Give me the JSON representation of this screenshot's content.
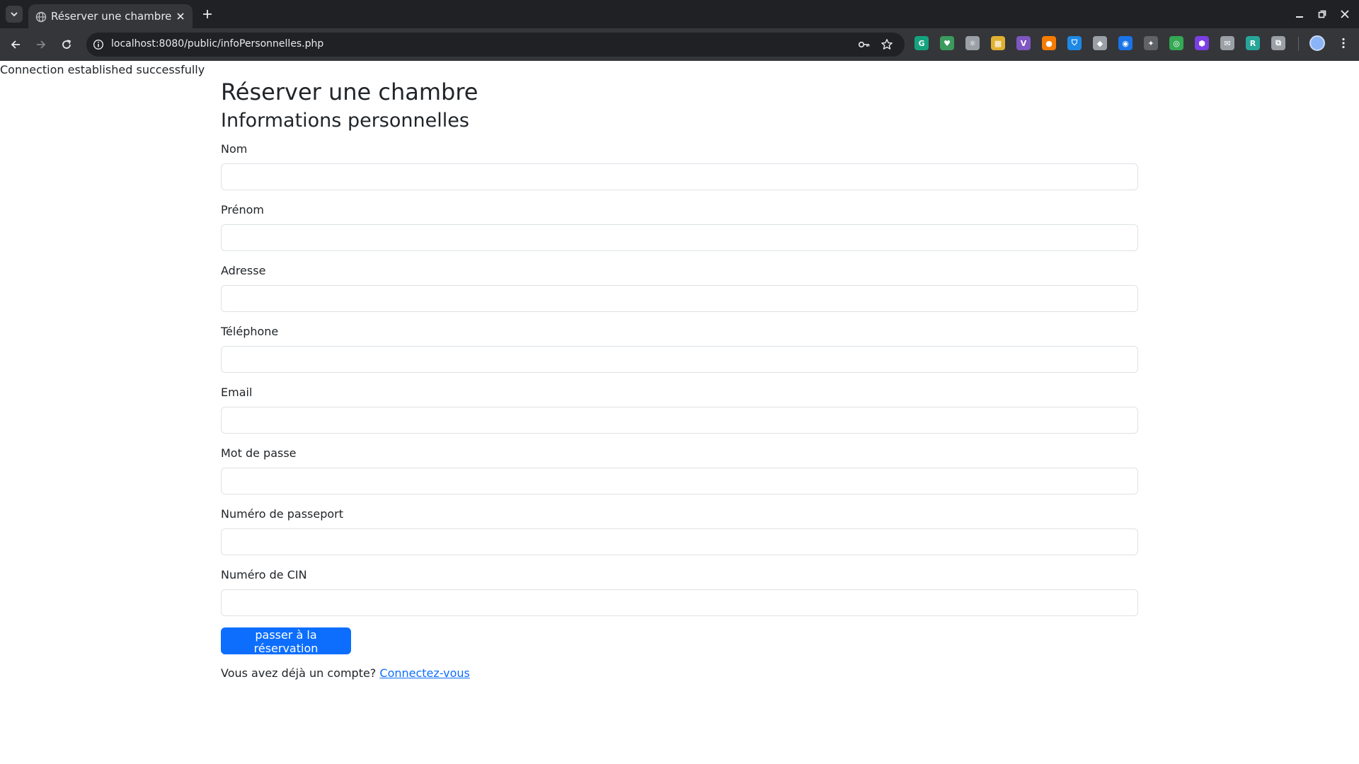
{
  "browser": {
    "tab_title": "Réserver une chambre",
    "url": "localhost:8080/public/infoPersonnelles.php",
    "extensions": [
      {
        "name": "grammarly-icon",
        "color": "#15a37f",
        "glyph": "G"
      },
      {
        "name": "ublock-icon",
        "color": "#3c9a5f",
        "glyph": "♥"
      },
      {
        "name": "react-devtools-icon",
        "color": "#9aa0a6",
        "glyph": "⚛"
      },
      {
        "name": "color-picker-icon",
        "color": "#e0b030",
        "glyph": "▦"
      },
      {
        "name": "vue-devtools-icon",
        "color": "#7e57c2",
        "glyph": "V"
      },
      {
        "name": "firebase-icon",
        "color": "#f57c00",
        "glyph": "●"
      },
      {
        "name": "vpn-shield-icon",
        "color": "#1e88e5",
        "glyph": "⛉"
      },
      {
        "name": "git-icon",
        "color": "#9aa0a6",
        "glyph": "◆"
      },
      {
        "name": "proxy-icon",
        "color": "#1a73e8",
        "glyph": "◉"
      },
      {
        "name": "darkreader-icon",
        "color": "#5f6368",
        "glyph": "✦"
      },
      {
        "name": "eye-extension-icon",
        "color": "#34a853",
        "glyph": "◎"
      },
      {
        "name": "hexagon-extension-icon",
        "color": "#7b3fe4",
        "glyph": "⬢"
      },
      {
        "name": "mail-extension-icon",
        "color": "#9aa0a6",
        "glyph": "✉"
      },
      {
        "name": "r-extension-icon",
        "color": "#26a69a",
        "glyph": "R"
      },
      {
        "name": "extensions-puzzle-icon",
        "color": "#9aa0a6",
        "glyph": "⧉"
      }
    ]
  },
  "page": {
    "status_message": "Connection established successfully",
    "title": "Réserver une chambre",
    "subtitle": "Informations personnelles",
    "fields": [
      {
        "label": "Nom",
        "value": "",
        "placeholder": ""
      },
      {
        "label": "Prénom",
        "value": "",
        "placeholder": ""
      },
      {
        "label": "Adresse",
        "value": "",
        "placeholder": ""
      },
      {
        "label": "Téléphone",
        "value": "",
        "placeholder": ""
      },
      {
        "label": "Email",
        "value": "",
        "placeholder": ""
      },
      {
        "label": "Mot de passe",
        "value": "",
        "placeholder": ""
      },
      {
        "label": "Numéro de passeport",
        "value": "",
        "placeholder": ""
      },
      {
        "label": "Numéro de CIN",
        "value": "",
        "placeholder": ""
      }
    ],
    "submit_label": "passer à la réservation",
    "login_prompt": "Vous avez déjà un compte?",
    "login_link": "Connectez-vous"
  }
}
